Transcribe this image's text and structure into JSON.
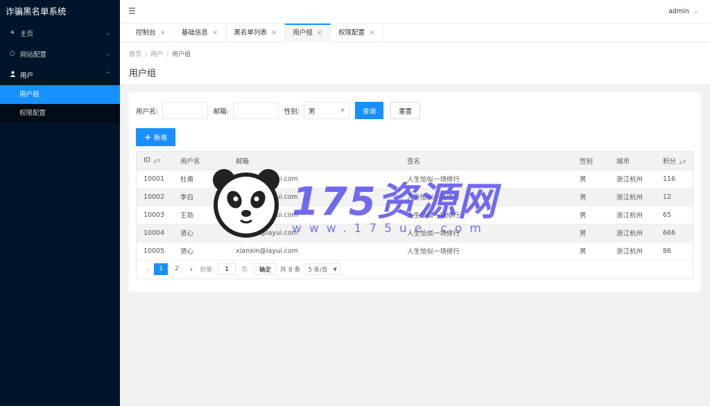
{
  "app": {
    "title": "诈骗黑名单系统"
  },
  "sidebar": {
    "items": [
      {
        "label": "主页",
        "icon": "send-icon",
        "arrow": "chevron-down"
      },
      {
        "label": "网站配置",
        "icon": "cube-icon",
        "arrow": "chevron-down"
      },
      {
        "label": "用户",
        "icon": "user-icon",
        "arrow": "chevron-up"
      }
    ],
    "subitems": [
      {
        "label": "用户组"
      },
      {
        "label": "权限配置"
      }
    ]
  },
  "header": {
    "user": "admin"
  },
  "tabs": [
    {
      "label": "控制台"
    },
    {
      "label": "基础信息"
    },
    {
      "label": "黑名单列表"
    },
    {
      "label": "用户组"
    },
    {
      "label": "权限配置"
    }
  ],
  "breadcrumb": {
    "home": "首页",
    "parent": "用户",
    "current": "用户组",
    "sep": "/"
  },
  "page": {
    "title": "用户组"
  },
  "search": {
    "username_label": "用户名:",
    "email_label": "邮箱:",
    "gender_label": "性别:",
    "gender_value": "男",
    "query_button": "查询",
    "reset_button": "重置"
  },
  "add_button": "新增",
  "table": {
    "columns": [
      "ID",
      "用户名",
      "邮箱",
      "签名",
      "性别",
      "城市",
      "积分"
    ],
    "rows": [
      [
        "10001",
        "杜甫",
        "xianxin@layui.com",
        "人生恰似一场修行",
        "男",
        "浙江杭州",
        "116"
      ],
      [
        "10002",
        "李白",
        "xianxin@layui.com",
        "人生恰似一场修行",
        "男",
        "浙江杭州",
        "12"
      ],
      [
        "10003",
        "王勃",
        "xianxin@layui.com",
        "人生恰似一场修行",
        "男",
        "浙江杭州",
        "65"
      ],
      [
        "10004",
        "贤心",
        "xianxin@layui.com",
        "人生恰似一场修行",
        "男",
        "浙江杭州",
        "666"
      ],
      [
        "10005",
        "贤心",
        "xianxin@layui.com",
        "人生恰似一场修行",
        "男",
        "浙江杭州",
        "86"
      ]
    ]
  },
  "pager": {
    "pages": [
      "1",
      "2"
    ],
    "goto_label": "到第",
    "page_value": "1",
    "page_unit": "页",
    "confirm": "确定",
    "total": "共 8 条",
    "limit": "5 条/页"
  },
  "watermark": {
    "text": "175资源网",
    "sub": "www.175ue.com"
  },
  "colors": {
    "sidebar_bg": "#001529",
    "accent": "#1890ff"
  }
}
